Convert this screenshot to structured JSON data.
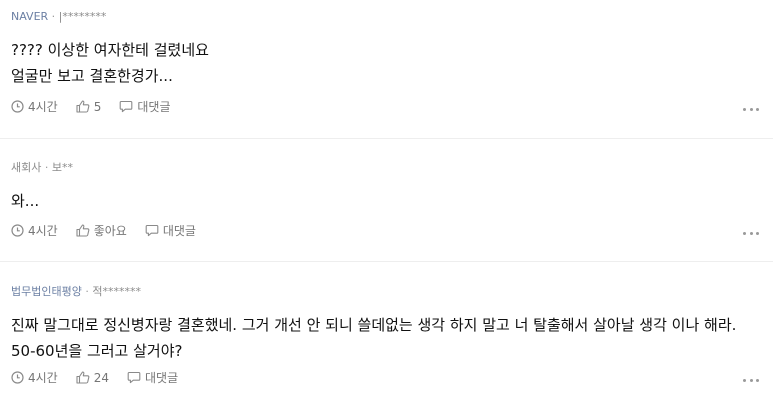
{
  "comments": [
    {
      "source": "NAVER",
      "separator": "·",
      "writer": "|********",
      "text": "???? 이상한 여자한테 걸렸네요\n얼굴만 보고 결혼한경가...",
      "time": "4시간",
      "likes": "5",
      "reply_label": "대댓글"
    },
    {
      "source": "새회사",
      "separator": "·",
      "writer": "보**",
      "text": "와...",
      "time": "4시간",
      "likes": "좋아요",
      "reply_label": "대댓글"
    },
    {
      "source": "법무법인태평양",
      "separator": "·",
      "writer": "적*******",
      "text": "진짜 말그대로 정신병자랑 결혼했네. 그거 개선 안 되니 쓸데없는 생각 하지 말고 너 탈출해서 살아날 생각 이나 해라. 50-60년을 그러고 살거야?",
      "time": "4시간",
      "likes": "24",
      "reply_label": "대댓글"
    }
  ],
  "colors": {
    "source_text": "#6b7fa3",
    "writer_text": "#8b8b8b",
    "action_text": "#767676",
    "divider": "#eeeeee"
  },
  "icons": {
    "time": "clock-icon",
    "like": "thumbs-up-icon",
    "reply": "speech-bubble-icon",
    "more": "more-dots-icon"
  }
}
